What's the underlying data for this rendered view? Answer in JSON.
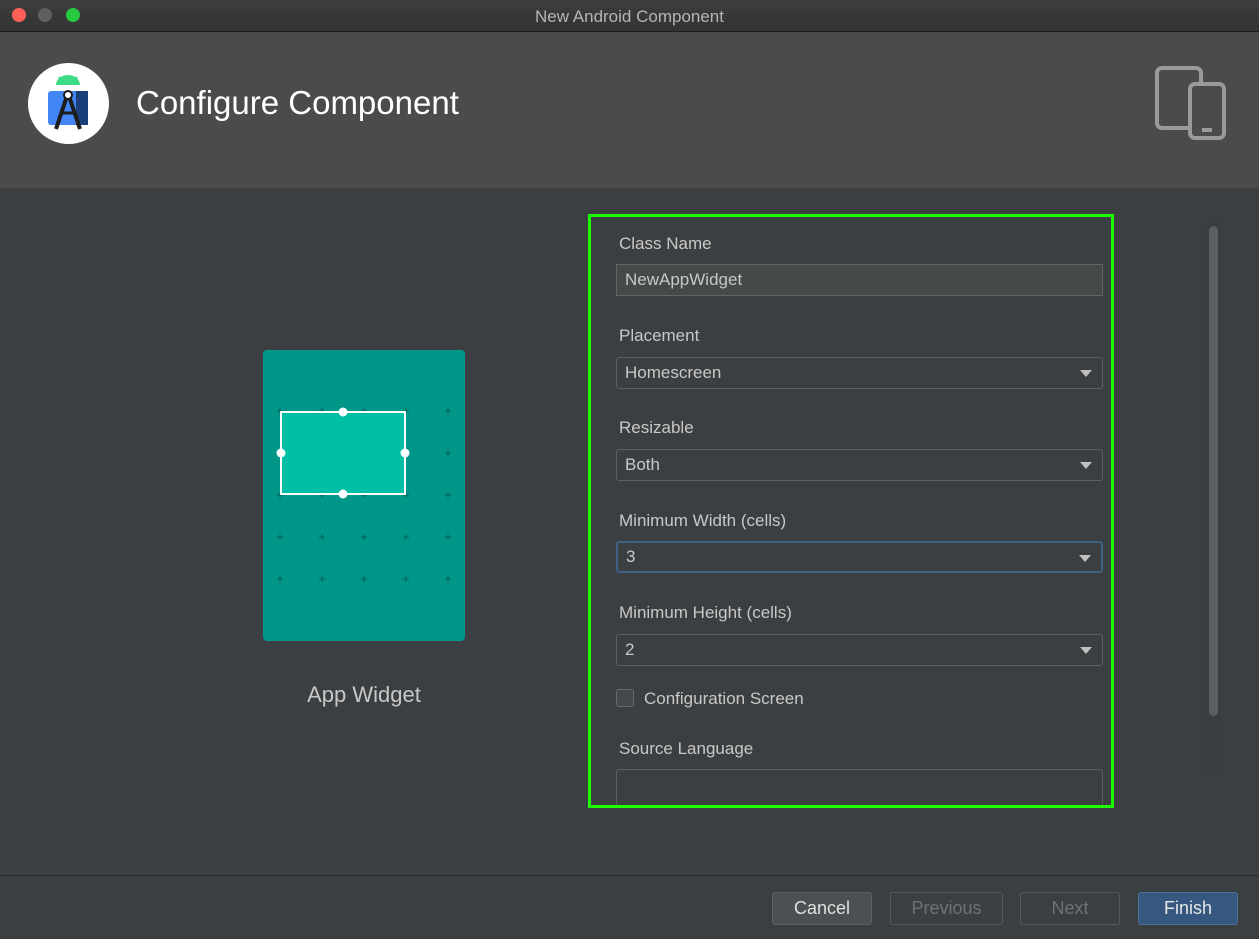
{
  "window": {
    "title": "New Android Component"
  },
  "header": {
    "title": "Configure Component",
    "logo_icon": "android-studio-icon",
    "device_icon": "tablet-phone-icon"
  },
  "preview": {
    "label": "App Widget",
    "card_color": "#009688",
    "widget_color": "#00bfa5"
  },
  "form": {
    "class_name": {
      "label": "Class Name",
      "value": "NewAppWidget"
    },
    "placement": {
      "label": "Placement",
      "value": "Homescreen"
    },
    "resizable": {
      "label": "Resizable",
      "value": "Both"
    },
    "min_width": {
      "label": "Minimum Width (cells)",
      "value": "3"
    },
    "min_height": {
      "label": "Minimum Height (cells)",
      "value": "2"
    },
    "config_screen": {
      "label": "Configuration Screen",
      "checked": false
    },
    "source_language": {
      "label": "Source Language"
    }
  },
  "footer": {
    "cancel_label": "Cancel",
    "previous_label": "Previous",
    "next_label": "Next",
    "finish_label": "Finish"
  },
  "colors": {
    "highlight_border": "#1dff00",
    "finish_button": "#365880"
  }
}
